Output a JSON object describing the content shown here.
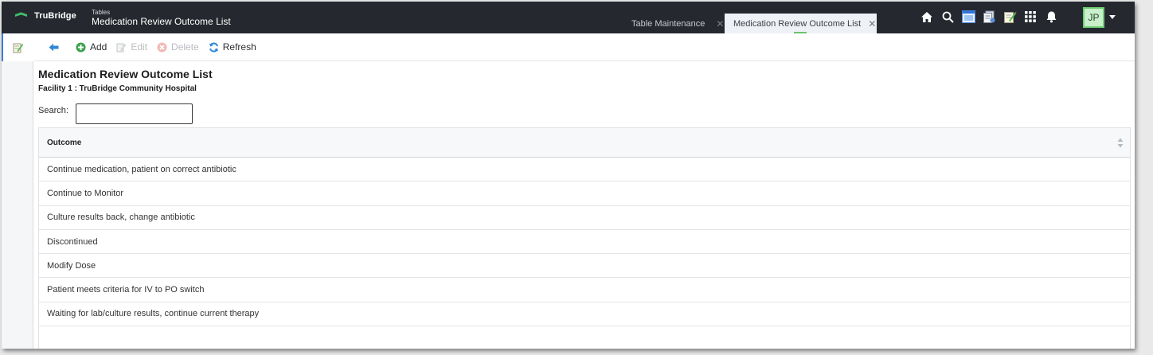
{
  "app": {
    "brand": "TruBridge",
    "section": "Tables",
    "title": "Medication Review Outcome List"
  },
  "tabs": [
    {
      "label": "Table Maintenance",
      "active": false
    },
    {
      "label": "Medication Review Outcome List",
      "active": true
    }
  ],
  "header_icons": [
    "home-icon",
    "search-icon",
    "window-icon",
    "documents-icon",
    "notes-icon",
    "apps-grid-icon",
    "bell-icon"
  ],
  "user": {
    "initials": "JP"
  },
  "toolbar": {
    "back_label": "",
    "add_label": "Add",
    "edit_label": "Edit",
    "delete_label": "Delete",
    "refresh_label": "Refresh"
  },
  "page": {
    "title": "Medication Review Outcome List",
    "facility": "Facility 1 : TruBridge Community Hospital"
  },
  "search": {
    "label": "Search:",
    "value": "",
    "placeholder": ""
  },
  "table": {
    "column_header": "Outcome",
    "rows": [
      "Continue medication, patient on correct antibiotic",
      "Continue to Monitor",
      "Culture results back, change antibiotic",
      "Discontinued",
      "Modify Dose",
      "Patient meets criteria for IV to PO switch",
      "Waiting for lab/culture results, continue current therapy"
    ]
  },
  "colors": {
    "topbar": "#25292f",
    "accent_green": "#6cc070",
    "rail_active": "#3d7bd9"
  }
}
